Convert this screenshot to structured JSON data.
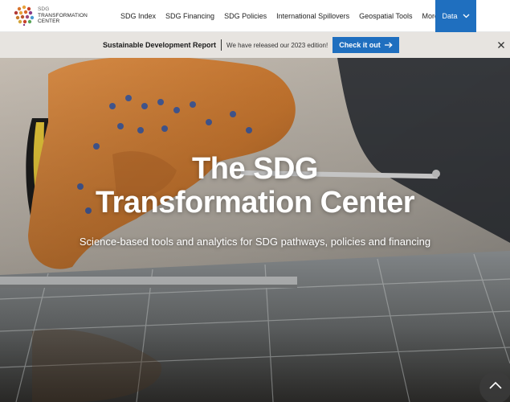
{
  "brand": {
    "line1": "SDG",
    "line2": "TRANSFORMATION",
    "line3": "CENTER",
    "colors": [
      "#e8a33d",
      "#c8432b",
      "#8a3a86",
      "#4a9bd1",
      "#5aa55a"
    ]
  },
  "nav": {
    "items": [
      "SDG Index",
      "SDG Financing",
      "SDG Policies",
      "International Spillovers",
      "Geospatial Tools",
      "More"
    ],
    "data_label": "Data",
    "accent": "#1f6fbf"
  },
  "announcement": {
    "title": "Sustainable Development Report",
    "text": "We have released our 2023 edition!",
    "button": "Check it out",
    "button_icon": "arrow-right-icon",
    "close_icon": "close-icon"
  },
  "hero": {
    "title_line1": "The SDG",
    "title_line2": "Transformation Center",
    "subtitle": "Science-based tools and analytics for SDG pathways, policies and financing",
    "scroll_icon": "chevron-up-icon"
  }
}
